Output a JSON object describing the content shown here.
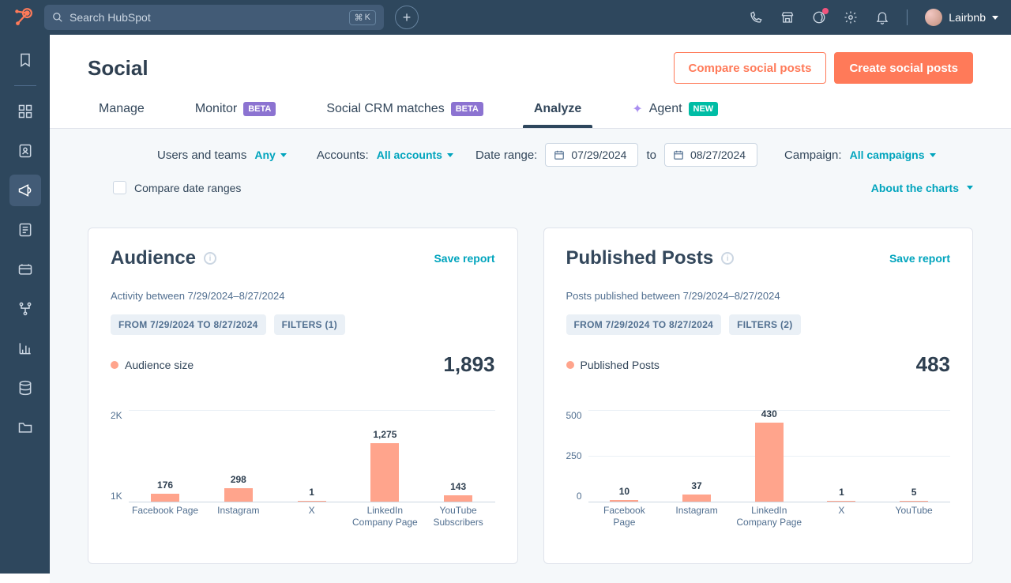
{
  "app": "HubSpot",
  "search": {
    "placeholder": "Search HubSpot",
    "kbd1": "⌘",
    "kbd2": "K"
  },
  "topnav_icons": [
    "phone",
    "store",
    "chat",
    "gear",
    "bell"
  ],
  "account": {
    "name": "Lairbnb"
  },
  "leftnav": [
    {
      "icon": "bookmark"
    },
    {
      "sep": true
    },
    {
      "icon": "apps"
    },
    {
      "icon": "contact"
    },
    {
      "icon": "megaphone",
      "active": true
    },
    {
      "icon": "news"
    },
    {
      "icon": "commerce"
    },
    {
      "icon": "workflow"
    },
    {
      "icon": "reports"
    },
    {
      "icon": "data"
    },
    {
      "icon": "folder"
    }
  ],
  "page_title": "Social",
  "header_actions": {
    "compare": "Compare social posts",
    "create": "Create social posts"
  },
  "tabs": [
    {
      "label": "Manage"
    },
    {
      "label": "Monitor",
      "badge": "BETA",
      "badgeClass": "badge-beta"
    },
    {
      "label": "Social CRM matches",
      "badge": "BETA",
      "badgeClass": "badge-beta"
    },
    {
      "label": "Analyze",
      "active": true
    },
    {
      "label": "Agent",
      "badge": "NEW",
      "badgeClass": "badge-new",
      "sparkle": true
    }
  ],
  "filters": {
    "users_teams_label": "Users and teams",
    "users_teams_value": "Any",
    "accounts_label": "Accounts:",
    "accounts_value": "All accounts",
    "date_range_label": "Date range:",
    "date_from": "07/29/2024",
    "date_to_sep": "to",
    "date_to": "08/27/2024",
    "campaign_label": "Campaign:",
    "campaign_value": "All campaigns",
    "compare_label": "Compare date ranges",
    "about_charts": "About the charts"
  },
  "cards": {
    "audience": {
      "title": "Audience",
      "save": "Save report",
      "subtitle": "Activity between 7/29/2024–8/27/2024",
      "chip_range": "FROM 7/29/2024 TO 8/27/2024",
      "chip_filters": "FILTERS (1)",
      "legend": "Audience size",
      "total": "1,893"
    },
    "published": {
      "title": "Published Posts",
      "save": "Save report",
      "subtitle": "Posts published between 7/29/2024–8/27/2024",
      "chip_range": "FROM 7/29/2024 TO 8/27/2024",
      "chip_filters": "FILTERS (2)",
      "legend": "Published Posts",
      "total": "483"
    }
  },
  "chart_data": [
    {
      "id": "audience",
      "type": "bar",
      "title": "Audience",
      "xlabel": "",
      "ylabel": "",
      "categories": [
        "Facebook Page",
        "Instagram",
        "X",
        "LinkedIn Company Page",
        "YouTube Subscribers"
      ],
      "values": [
        176,
        298,
        1,
        1275,
        143
      ],
      "ylim": [
        0,
        2000
      ],
      "yticks": [
        "2K",
        "1K"
      ]
    },
    {
      "id": "published",
      "type": "bar",
      "title": "Published Posts",
      "xlabel": "",
      "ylabel": "",
      "categories": [
        "Facebook Page",
        "Instagram",
        "LinkedIn Company Page",
        "X",
        "YouTube"
      ],
      "values": [
        10,
        37,
        430,
        1,
        5
      ],
      "ylim": [
        0,
        500
      ],
      "yticks": [
        "500",
        "250",
        "0"
      ]
    }
  ]
}
